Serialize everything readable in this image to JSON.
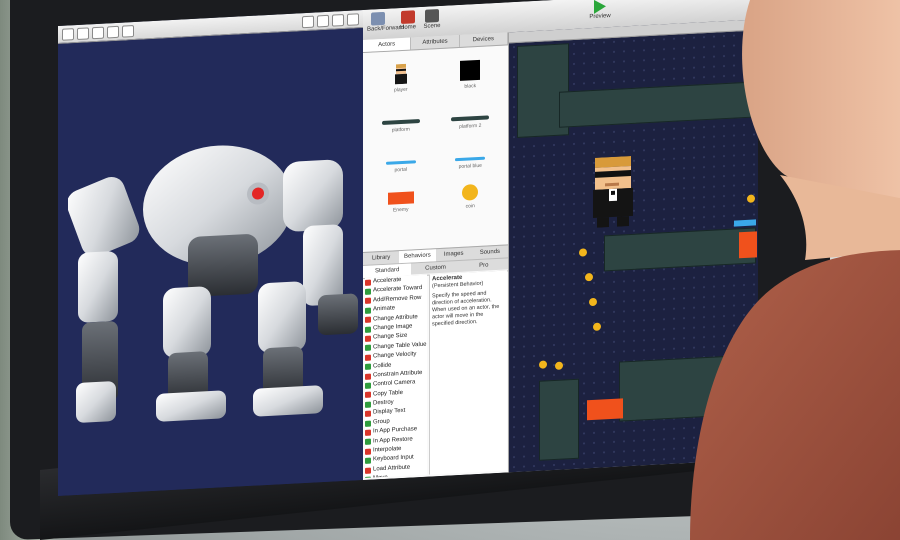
{
  "editor": {
    "title": ""
  },
  "gamesalad": {
    "toolbar": {
      "back_label": "Back/Forward",
      "home_label": "Home",
      "scene_label": "Scene",
      "preview_label": "Preview"
    },
    "library_tabs": [
      "Actors",
      "Attributes",
      "Devices"
    ],
    "actors": [
      {
        "name": "player"
      },
      {
        "name": "black"
      },
      {
        "name": "platform"
      },
      {
        "name": "platform 2"
      },
      {
        "name": "portal"
      },
      {
        "name": "portal blue"
      },
      {
        "name": "Enemy"
      },
      {
        "name": "coin"
      }
    ],
    "panel_tabs": [
      "Library",
      "Behaviors",
      "Images",
      "Sounds"
    ],
    "panel_subtabs": [
      "Standard",
      "Custom",
      "Pro"
    ],
    "behaviors": [
      "Accelerate",
      "Accelerate Toward",
      "Add/Remove Row",
      "Animate",
      "Change Attribute",
      "Change Image",
      "Change Size",
      "Change Table Value",
      "Change Velocity",
      "Collide",
      "Constrain Attribute",
      "Control Camera",
      "Copy Table",
      "Destroy",
      "Display Text",
      "Group",
      "In App Purchase",
      "In App Restore",
      "Interpolate",
      "Keyboard Input",
      "Load Attribute",
      "Move"
    ],
    "behavior_colors": [
      "#d9362b",
      "#2f9c3d"
    ],
    "help": {
      "title": "Accelerate",
      "subtitle": "(Persistent Behavior)",
      "text": "Specify the speed and direction of acceleration. When used on an actor, the actor will move in the specified direction."
    }
  },
  "colors": {
    "scene_bg": "#1c2140",
    "tile": "#2d4442",
    "coin": "#f2b51c",
    "lava": "#f0511c",
    "editor_bg": "#222a5a"
  }
}
